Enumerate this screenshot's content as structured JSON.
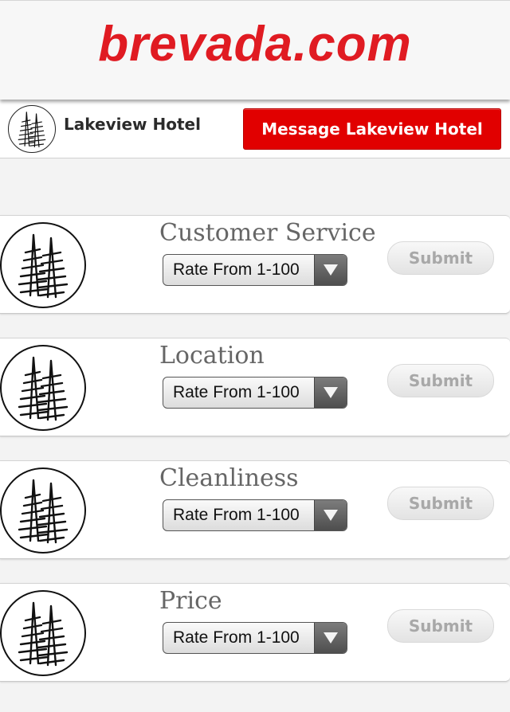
{
  "header": {
    "logo_text": "brevada.com",
    "brand_color": "#e01b22"
  },
  "hotel": {
    "name": "Lakeview Hotel",
    "message_button": "Message Lakeview Hotel",
    "avatar_icon": "pine-trees-logo-icon"
  },
  "categories": [
    {
      "title": "Customer Service",
      "select_value": "Rate From 1-100",
      "submit": "Submit"
    },
    {
      "title": "Location",
      "select_value": "Rate From 1-100",
      "submit": "Submit"
    },
    {
      "title": "Cleanliness",
      "select_value": "Rate From 1-100",
      "submit": "Submit"
    },
    {
      "title": "Price",
      "select_value": "Rate From 1-100",
      "submit": "Submit"
    }
  ],
  "colors": {
    "message_button": "#e10000",
    "submit_text": "#a8a8a8"
  }
}
